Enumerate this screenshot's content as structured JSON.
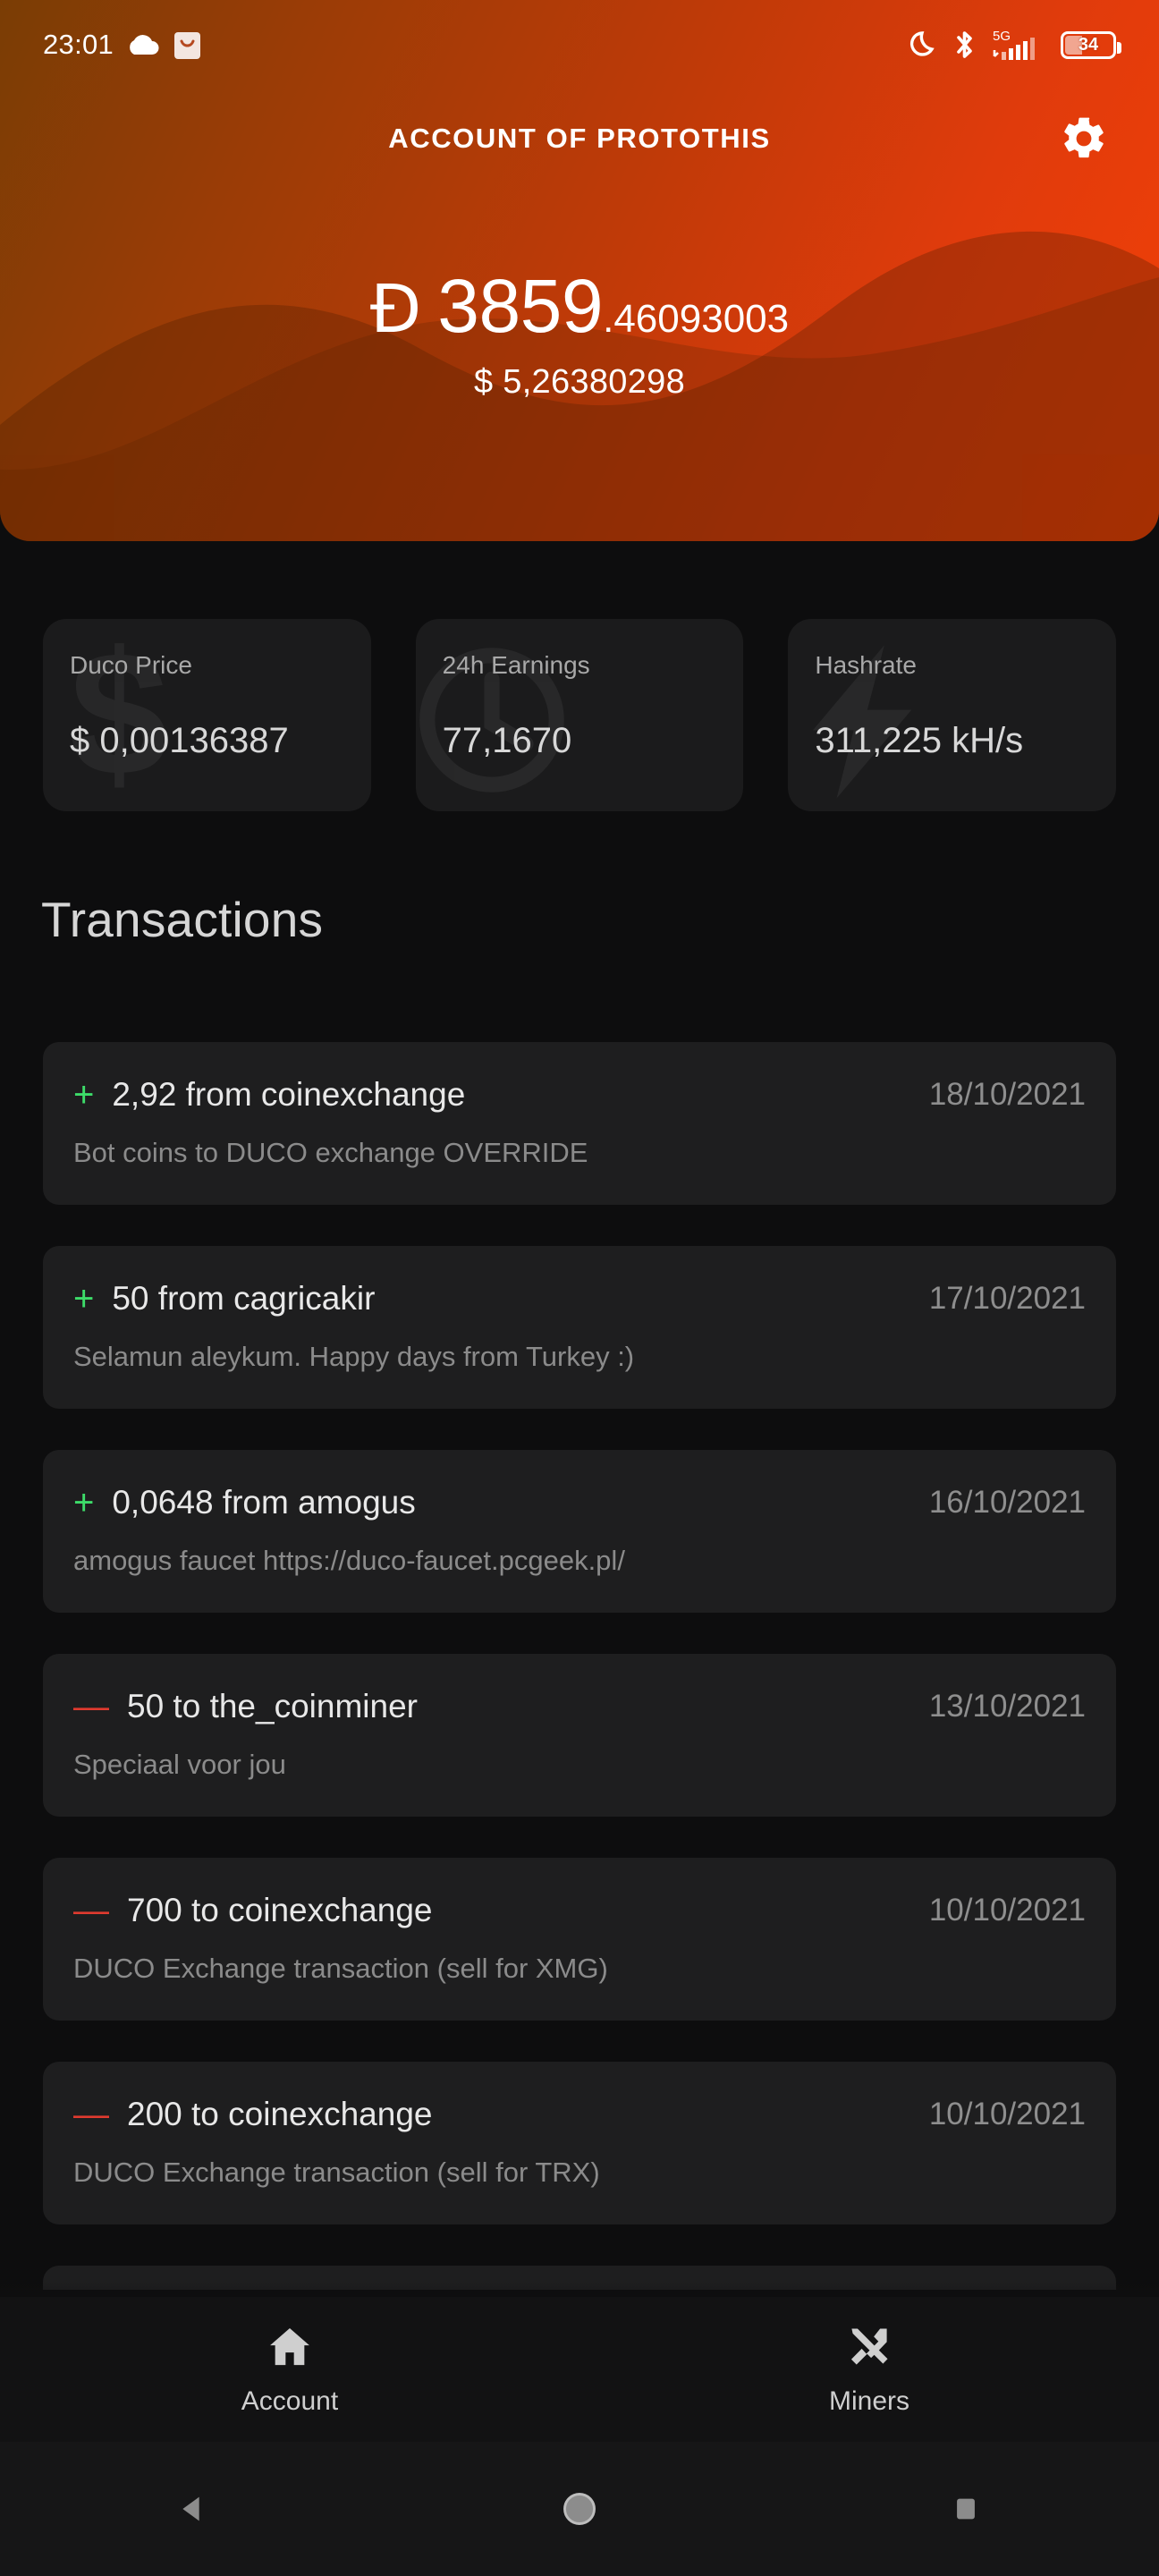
{
  "statusbar": {
    "time": "23:01",
    "left_icons": [
      "cloud-icon",
      "shopping-bag-icon"
    ],
    "right_icons": [
      "do-not-disturb-moon-icon",
      "bluetooth-icon",
      "signal-5g-icon"
    ],
    "network_label": "5G",
    "battery_percent": "34"
  },
  "appbar": {
    "title": "ACCOUNT OF PROTOTHIS",
    "settings_icon": "gear-icon"
  },
  "balance": {
    "currency_symbol": "Ð",
    "integer_part": "3859",
    "decimal_part": ".46093003",
    "usd_value": "$ 5,26380298"
  },
  "stats": [
    {
      "label": "Duco Price",
      "value": "$ 0,00136387",
      "watermark": "dollar-sign-icon"
    },
    {
      "label": "24h Earnings",
      "value": "77,1670",
      "watermark": "clock-icon"
    },
    {
      "label": "Hashrate",
      "value": "311,225 kH/s",
      "watermark": "lightning-bolt-icon"
    }
  ],
  "transactions": {
    "heading": "Transactions",
    "items": [
      {
        "sign": "+",
        "direction": "in",
        "amount_text": "2,92 from coinexchange",
        "date": "18/10/2021",
        "memo": "Bot coins to DUCO exchange OVERRIDE"
      },
      {
        "sign": "+",
        "direction": "in",
        "amount_text": "50 from cagricakir",
        "date": "17/10/2021",
        "memo": "Selamun aleykum. Happy days from Turkey :)"
      },
      {
        "sign": "+",
        "direction": "in",
        "amount_text": "0,0648 from amogus",
        "date": "16/10/2021",
        "memo": "amogus faucet https://duco-faucet.pcgeek.pl/"
      },
      {
        "sign": "—",
        "direction": "out",
        "amount_text": "50 to the_coinminer",
        "date": "13/10/2021",
        "memo": "Speciaal voor jou"
      },
      {
        "sign": "—",
        "direction": "out",
        "amount_text": "700 to coinexchange",
        "date": "10/10/2021",
        "memo": "DUCO Exchange transaction (sell for XMG)"
      },
      {
        "sign": "—",
        "direction": "out",
        "amount_text": "200 to coinexchange",
        "date": "10/10/2021",
        "memo": "DUCO Exchange transaction (sell for TRX)"
      }
    ]
  },
  "bottom_nav": [
    {
      "label": "Account",
      "icon": "home-icon",
      "active": true
    },
    {
      "label": "Miners",
      "icon": "tools-icon",
      "active": false
    }
  ],
  "system_nav": [
    {
      "name": "back-button",
      "icon": "triangle-left-icon"
    },
    {
      "name": "home-button",
      "icon": "circle-icon"
    },
    {
      "name": "recents-button",
      "icon": "square-icon"
    }
  ],
  "colors": {
    "accent_red": "#f24007",
    "header_dark": "#7a3d05",
    "incoming_green": "#3ddc69",
    "outgoing_red": "#e03a2f",
    "background": "#0d0d0e",
    "card": "#1e1e1f"
  }
}
